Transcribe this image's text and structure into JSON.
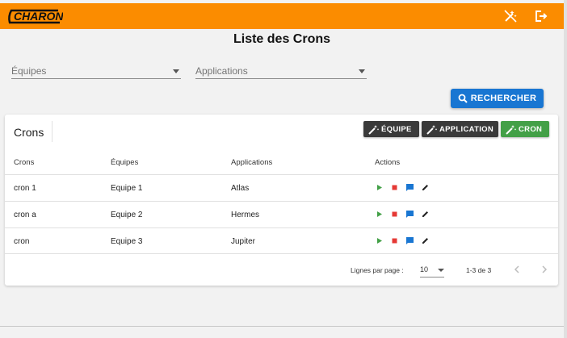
{
  "app": {
    "logo_text": "CHARON",
    "accent_color": "#fb8c00"
  },
  "header": {
    "icons": [
      "magic-off-icon",
      "logout-icon"
    ]
  },
  "page": {
    "title": "Liste des Crons"
  },
  "filters": {
    "teams_placeholder": "Équipes",
    "apps_placeholder": "Applications",
    "search_label": "RECHERCHER"
  },
  "card": {
    "title": "Crons",
    "buttons": {
      "team": "ÉQUIPE",
      "application": "APPLICATION",
      "cron": "CRON"
    },
    "columns": [
      "Crons",
      "Équipes",
      "Applications",
      "Actions"
    ],
    "rows": [
      {
        "cron": "cron 1",
        "team": "Equipe 1",
        "app": "Atlas"
      },
      {
        "cron": "cron a",
        "team": "Equipe 2",
        "app": "Hermes"
      },
      {
        "cron": "cron",
        "team": "Equipe 3",
        "app": "Jupiter"
      }
    ],
    "row_actions": [
      "play-icon",
      "stop-icon",
      "comment-icon",
      "edit-icon"
    ]
  },
  "pagination": {
    "rows_per_page_label": "Lignes par page :",
    "rows_per_page_value": "10",
    "range": "1-3 de 3"
  }
}
